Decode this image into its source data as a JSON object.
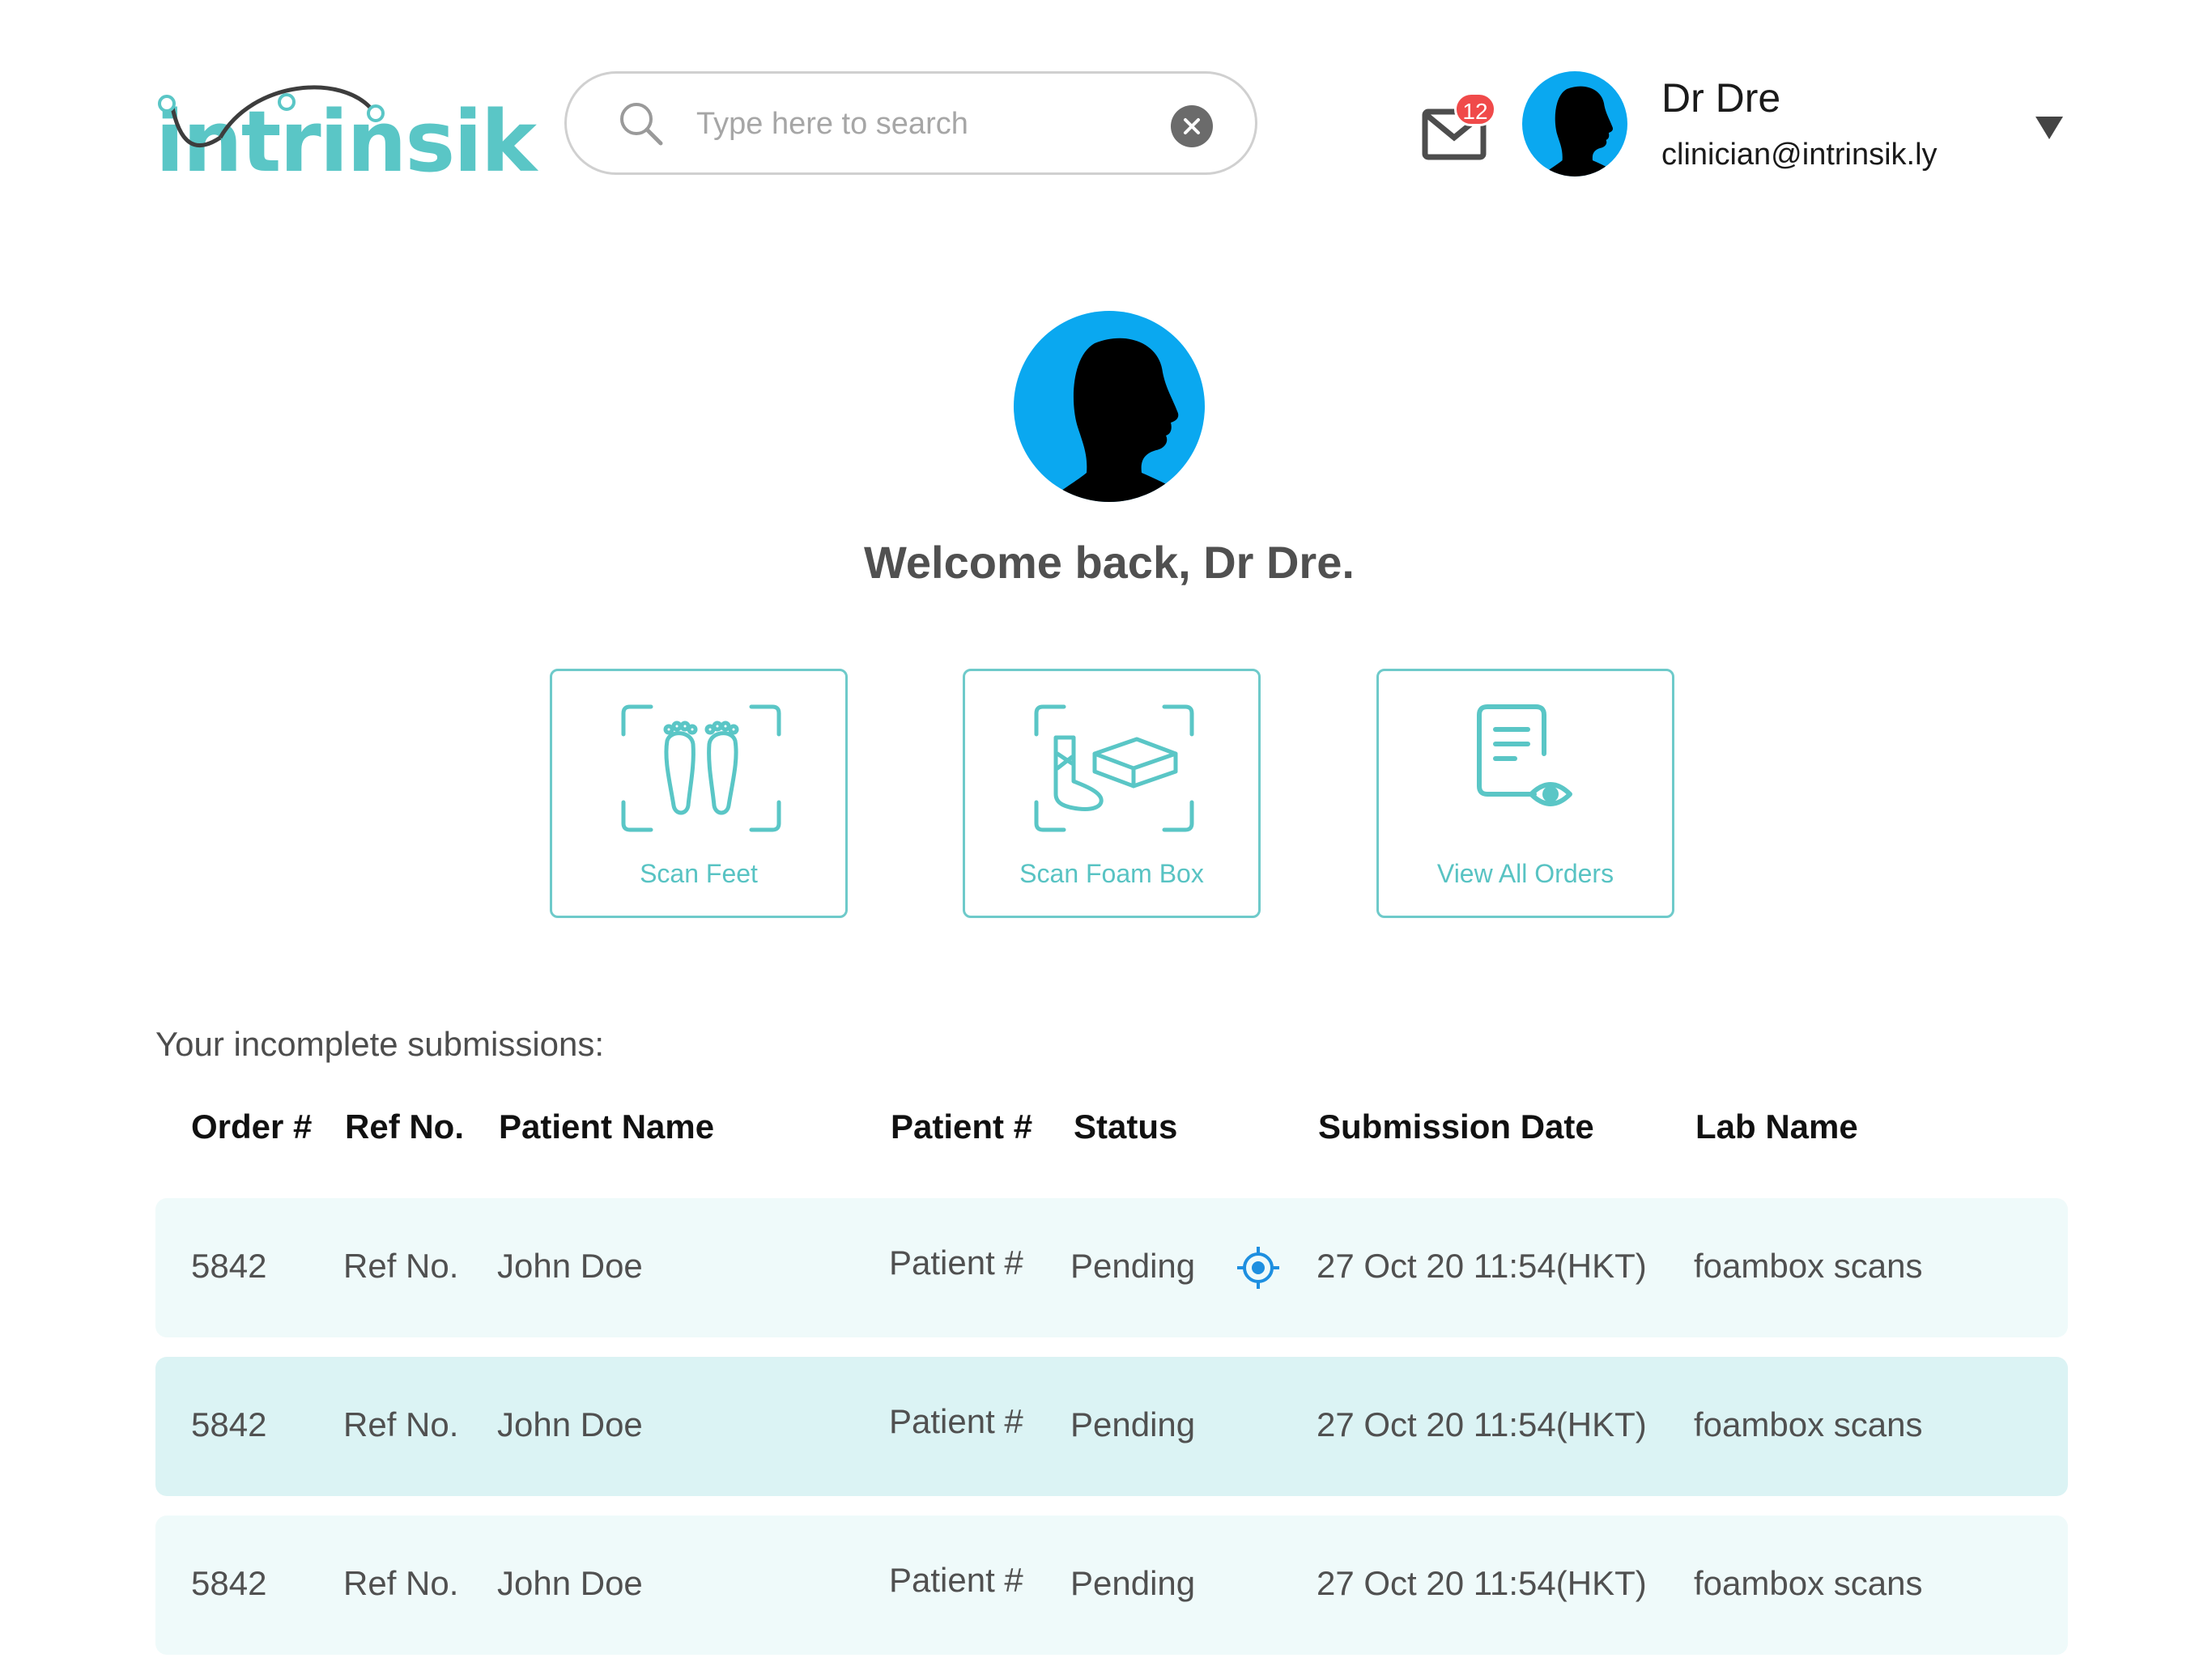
{
  "header": {
    "logo_text": "intrinsik",
    "search": {
      "placeholder": "Type here to search",
      "value": ""
    },
    "notifications": {
      "count": "12"
    },
    "user": {
      "name": "Dr Dre",
      "email": "clinician@intrinsik.ly"
    }
  },
  "welcome": {
    "message": "Welcome back, Dr Dre."
  },
  "actions": [
    {
      "label": "Scan Feet",
      "icon": "feet-scan-icon"
    },
    {
      "label": "Scan Foam Box",
      "icon": "foam-box-scan-icon"
    },
    {
      "label": "View All Orders",
      "icon": "view-orders-icon"
    }
  ],
  "submissions": {
    "title": "Your incomplete submissions:",
    "columns": [
      "Order #",
      "Ref No.",
      "Patient Name",
      "Patient #",
      "Status",
      "Submission Date",
      "Lab Name"
    ],
    "rows": [
      {
        "order": "5842",
        "ref": "Ref No.",
        "patient_name": "John Doe",
        "patient_no": "Patient #",
        "status": "Pending",
        "date": "27 Oct 20 11:54(HKT)",
        "lab": "foambox scans",
        "status_icon": "target-icon"
      },
      {
        "order": "5842",
        "ref": "Ref No.",
        "patient_name": "John Doe",
        "patient_no": "Patient #",
        "status": "Pending",
        "date": "27 Oct 20 11:54(HKT)",
        "lab": "foambox scans"
      },
      {
        "order": "5842",
        "ref": "Ref No.",
        "patient_name": "John Doe",
        "patient_no": "Patient #",
        "status": "Pending",
        "date": "27 Oct 20 11:54(HKT)",
        "lab": "foambox scans"
      }
    ]
  },
  "colors": {
    "accent": "#5ac6c6",
    "avatar_bg": "#0aa8f0",
    "badge": "#f04a4a",
    "row_light": "#effafa",
    "row_mid": "#dbf3f4",
    "status_icon": "#1e8fe0"
  }
}
